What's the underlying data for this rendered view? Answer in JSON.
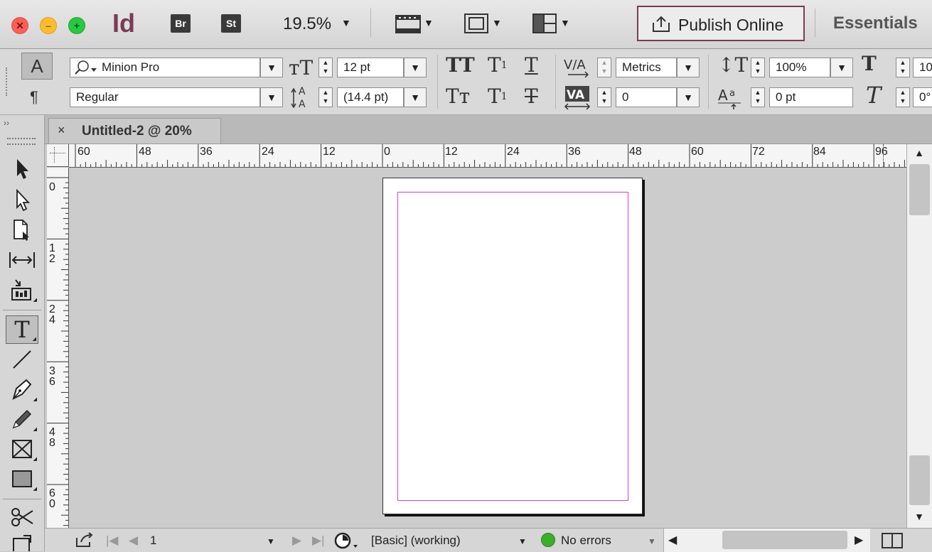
{
  "app": {
    "logo": "Id",
    "bridge_label": "Br",
    "stock_label": "St",
    "zoom": "19.5%",
    "publish_label": "Publish Online",
    "workspace": "Essentials"
  },
  "control_panel": {
    "char_mode_label": "A",
    "para_mode_label": "¶",
    "font_family": "Minion Pro",
    "font_style": "Regular",
    "font_size": "12 pt",
    "leading": "(14.4 pt)",
    "kerning": "Metrics",
    "tracking": "0",
    "vertical_scale": "100%",
    "baseline_shift": "0 pt",
    "horizontal_scale_partial": "10",
    "skew_partial": "0°"
  },
  "document": {
    "tab_title": "Untitled-2 @ 20%",
    "close_glyph": "×"
  },
  "rulers": {
    "horizontal_labels": [
      "60",
      "48",
      "36",
      "24",
      "12",
      "0",
      "12",
      "24",
      "36",
      "48",
      "60",
      "72",
      "84",
      "96"
    ],
    "vertical_labels": [
      "0",
      "1\n2",
      "2\n4",
      "3\n6",
      "4\n8",
      "6\n0"
    ]
  },
  "status": {
    "page_number": "1",
    "preflight_profile": "[Basic] (working)",
    "error_status": "No errors"
  },
  "colors": {
    "accent": "#7a3b55",
    "margin_guide": "#d640d6",
    "ok_indicator": "#3cae2c"
  }
}
